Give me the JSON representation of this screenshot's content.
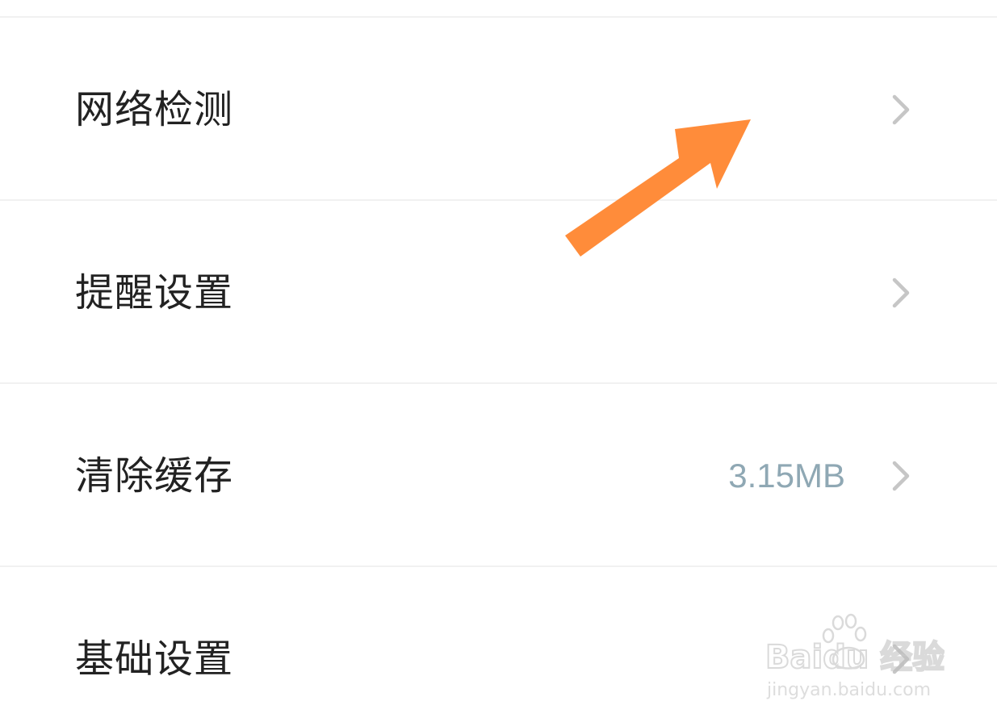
{
  "settings": {
    "items": [
      {
        "label": "网络检测",
        "value": ""
      },
      {
        "label": "提醒设置",
        "value": ""
      },
      {
        "label": "清除缓存",
        "value": "3.15MB"
      },
      {
        "label": "基础设置",
        "value": ""
      }
    ]
  },
  "annotation": {
    "arrow_color": "#ff8c3a"
  },
  "watermark": {
    "brand": "Baidu 经验",
    "url": "jingyan.baidu.com"
  },
  "icons": {
    "chevron": "chevron-right-icon",
    "arrow": "pointer-arrow-icon",
    "paw": "baidu-paw-icon"
  }
}
